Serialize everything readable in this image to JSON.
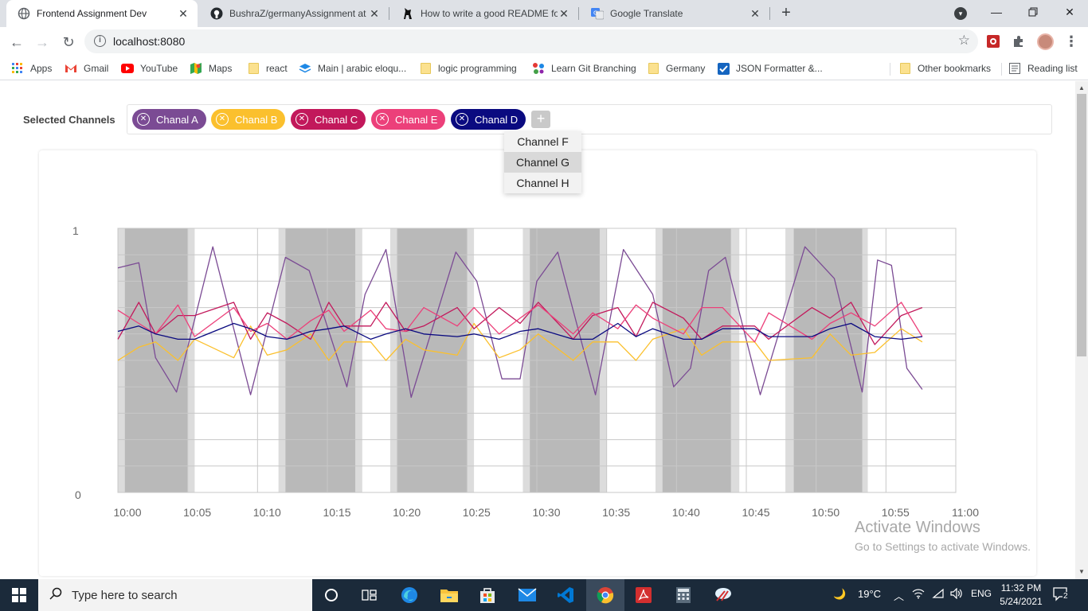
{
  "browser": {
    "tabs": [
      {
        "title": "Frontend Assignment Dev",
        "icon": "globe-icon",
        "active": true
      },
      {
        "title": "BushraZ/germanyAssignment at",
        "icon": "github-icon",
        "active": false
      },
      {
        "title": "How to write a good README fo",
        "icon": "dev-icon",
        "active": false
      },
      {
        "title": "Google Translate",
        "icon": "translate-icon",
        "active": false
      }
    ],
    "url": "localhost:8080",
    "bookmarks": [
      {
        "label": "Apps",
        "icon": "apps-grid-icon"
      },
      {
        "label": "Gmail",
        "icon": "gmail-icon"
      },
      {
        "label": "YouTube",
        "icon": "youtube-icon"
      },
      {
        "label": "Maps",
        "icon": "maps-icon"
      },
      {
        "label": "react",
        "icon": "folder-icon"
      },
      {
        "label": "Main | arabic eloqu...",
        "icon": "stack-icon"
      },
      {
        "label": "logic programming",
        "icon": "folder-icon"
      },
      {
        "label": "Learn Git Branching",
        "icon": "git-icon"
      },
      {
        "label": "Germany",
        "icon": "folder-icon"
      },
      {
        "label": "JSON Formatter &...",
        "icon": "checkbox-icon"
      },
      {
        "label": "Other bookmarks",
        "icon": "folder-icon"
      },
      {
        "label": "Reading list",
        "icon": "reading-list-icon"
      }
    ]
  },
  "page": {
    "selected_label": "Selected Channels",
    "chips": [
      {
        "label": "Chanal A",
        "color": "#7b4b94"
      },
      {
        "label": "Chanal B",
        "color": "#fbc02d"
      },
      {
        "label": "Chanal C",
        "color": "#c2185b"
      },
      {
        "label": "Chanal E",
        "color": "#ec407a"
      },
      {
        "label": "Chanal D",
        "color": "#0a0a80"
      }
    ],
    "add_label": "+",
    "dropdown": [
      "Channel F",
      "Channel G",
      "Channel H"
    ],
    "dropdown_hover": "Channel G"
  },
  "chart_data": {
    "type": "line",
    "title": "",
    "xlabel": "",
    "ylabel": "",
    "ylim": [
      0,
      1
    ],
    "y_ticks": [
      "0",
      "1"
    ],
    "x_ticks": [
      "10:00",
      "10:05",
      "10:10",
      "10:15",
      "10:20",
      "10:25",
      "10:30",
      "10:35",
      "10:40",
      "10:45",
      "10:50",
      "10:55",
      "11:00"
    ],
    "x_min_minutes": 0,
    "x_max_minutes": 60,
    "grid": true,
    "legend": "none",
    "shaded_ranges": [
      {
        "from": 0.0,
        "to": 5.5,
        "dark_from": 0.5,
        "dark_to": 5.0
      },
      {
        "from": 11.5,
        "to": 17.5,
        "dark_from": 12.0,
        "dark_to": 17.0
      },
      {
        "from": 19.5,
        "to": 25.5,
        "dark_from": 20.0,
        "dark_to": 25.0
      },
      {
        "from": 29.0,
        "to": 35.0,
        "dark_from": 29.5,
        "dark_to": 34.5
      },
      {
        "from": 38.5,
        "to": 44.5,
        "dark_from": 39.0,
        "dark_to": 43.9
      },
      {
        "from": 47.8,
        "to": 53.7,
        "dark_from": 48.4,
        "dark_to": 53.3
      }
    ],
    "series": [
      {
        "color": "#7b4b94",
        "x": [
          0,
          1.5,
          2.7,
          4.2,
          6.8,
          9.5,
          12.0,
          13.7,
          16.4,
          17.7,
          19.2,
          21.0,
          24.2,
          25.7,
          27.5,
          28.8,
          30.0,
          31.5,
          34.2,
          36.2,
          38.3,
          39.8,
          41.0,
          42.3,
          43.5,
          46.0,
          49.2,
          51.3,
          53.3,
          54.4,
          55.4,
          56.5,
          57.6
        ],
        "y": [
          0.85,
          0.87,
          0.51,
          0.38,
          0.93,
          0.37,
          0.89,
          0.84,
          0.4,
          0.75,
          0.92,
          0.36,
          0.91,
          0.8,
          0.43,
          0.43,
          0.8,
          0.91,
          0.37,
          0.92,
          0.75,
          0.4,
          0.47,
          0.84,
          0.89,
          0.37,
          0.93,
          0.81,
          0.38,
          0.88,
          0.86,
          0.47,
          0.39
        ]
      },
      {
        "color": "#fbc02d",
        "x": [
          0,
          1.5,
          2.7,
          4.3,
          5.5,
          8.3,
          9.5,
          10.7,
          12.1,
          13.8,
          15.1,
          16.2,
          18.1,
          19.2,
          20.6,
          21.9,
          24.3,
          25.5,
          27.3,
          28.8,
          30.1,
          32.6,
          34.0,
          35.8,
          37.1,
          38.3,
          40.5,
          41.8,
          43.3,
          45.6,
          46.6,
          49.7,
          51.0,
          52.5,
          54.2,
          56.1,
          57.6
        ],
        "y": [
          0.5,
          0.55,
          0.57,
          0.5,
          0.58,
          0.51,
          0.63,
          0.52,
          0.54,
          0.6,
          0.5,
          0.57,
          0.57,
          0.5,
          0.58,
          0.54,
          0.52,
          0.64,
          0.51,
          0.54,
          0.6,
          0.5,
          0.57,
          0.57,
          0.5,
          0.58,
          0.62,
          0.52,
          0.57,
          0.57,
          0.5,
          0.51,
          0.6,
          0.52,
          0.53,
          0.62,
          0.57
        ]
      },
      {
        "color": "#c2185b",
        "x": [
          0,
          1.5,
          2.7,
          4.3,
          5.5,
          8.3,
          9.5,
          10.7,
          12.1,
          13.8,
          15.1,
          16.2,
          18.1,
          19.2,
          20.6,
          21.9,
          24.3,
          25.5,
          27.3,
          28.8,
          30.1,
          32.6,
          34.0,
          35.8,
          37.1,
          38.3,
          40.5,
          41.8,
          43.3,
          45.6,
          46.6,
          49.7,
          51.0,
          52.5,
          54.2,
          56.1,
          57.6
        ],
        "y": [
          0.58,
          0.72,
          0.6,
          0.67,
          0.67,
          0.72,
          0.58,
          0.68,
          0.64,
          0.58,
          0.72,
          0.63,
          0.63,
          0.72,
          0.61,
          0.63,
          0.7,
          0.62,
          0.7,
          0.64,
          0.72,
          0.58,
          0.67,
          0.7,
          0.59,
          0.72,
          0.66,
          0.58,
          0.63,
          0.63,
          0.58,
          0.7,
          0.66,
          0.72,
          0.56,
          0.67,
          0.7
        ]
      },
      {
        "color": "#ec407a",
        "x": [
          0,
          1.5,
          2.7,
          4.3,
          5.5,
          8.3,
          9.5,
          10.7,
          12.1,
          13.8,
          15.1,
          16.2,
          18.1,
          19.2,
          20.6,
          21.9,
          24.3,
          25.5,
          27.3,
          28.8,
          30.1,
          32.6,
          34.0,
          35.8,
          37.1,
          38.3,
          40.5,
          41.8,
          43.3,
          45.6,
          46.6,
          49.7,
          51.0,
          52.5,
          54.2,
          56.1,
          57.6
        ],
        "y": [
          0.69,
          0.64,
          0.6,
          0.71,
          0.59,
          0.7,
          0.61,
          0.64,
          0.58,
          0.65,
          0.69,
          0.61,
          0.69,
          0.62,
          0.61,
          0.7,
          0.63,
          0.7,
          0.6,
          0.66,
          0.71,
          0.6,
          0.68,
          0.62,
          0.71,
          0.66,
          0.6,
          0.7,
          0.7,
          0.57,
          0.68,
          0.58,
          0.64,
          0.68,
          0.63,
          0.72,
          0.59
        ]
      },
      {
        "color": "#0a0a80",
        "x": [
          0,
          1.5,
          2.7,
          4.3,
          5.5,
          8.3,
          9.5,
          10.7,
          12.1,
          13.8,
          15.1,
          16.2,
          18.1,
          19.2,
          20.6,
          21.9,
          24.3,
          25.5,
          27.3,
          28.8,
          30.1,
          32.6,
          34.0,
          35.8,
          37.1,
          38.3,
          40.5,
          41.8,
          43.3,
          45.6,
          46.6,
          49.7,
          51.0,
          52.5,
          54.2,
          56.1,
          57.6
        ],
        "y": [
          0.61,
          0.63,
          0.6,
          0.58,
          0.58,
          0.64,
          0.62,
          0.59,
          0.58,
          0.61,
          0.62,
          0.63,
          0.58,
          0.6,
          0.62,
          0.6,
          0.59,
          0.6,
          0.58,
          0.61,
          0.62,
          0.58,
          0.58,
          0.64,
          0.59,
          0.62,
          0.58,
          0.58,
          0.62,
          0.62,
          0.59,
          0.59,
          0.62,
          0.64,
          0.59,
          0.58,
          0.59
        ]
      }
    ]
  },
  "watermark": {
    "line1": "Activate Windows",
    "line2": "Go to Settings to activate Windows."
  },
  "taskbar": {
    "search_placeholder": "Type here to search",
    "temperature": "19°C",
    "language": "ENG",
    "time": "11:32 PM",
    "date": "5/24/2021",
    "notifications": "2"
  }
}
